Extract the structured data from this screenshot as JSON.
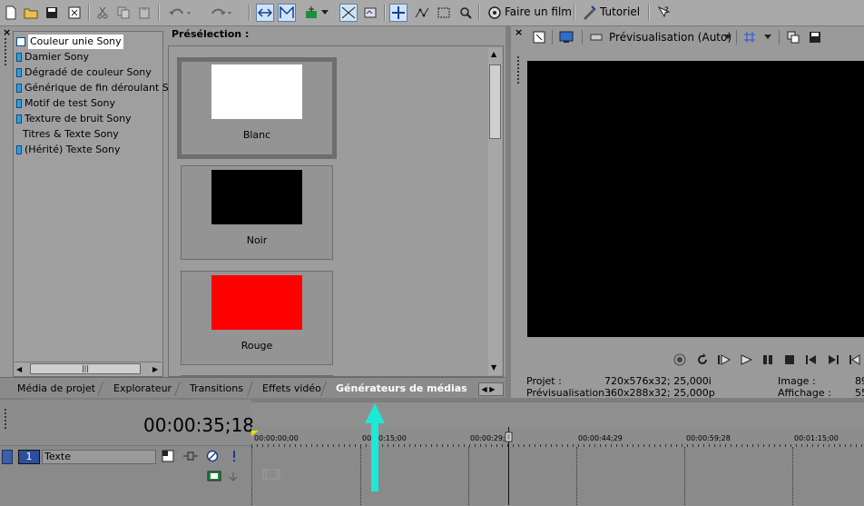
{
  "toolbar": {
    "make_movie_label": "Faire un film",
    "tutorial_label": "Tutoriel"
  },
  "generators": {
    "items": [
      "Couleur unie Sony",
      "Damier Sony",
      "Dégradé de couleur Sony",
      "Générique de fin déroulant Sony",
      "Motif de test Sony",
      "Texture de bruit Sony",
      "Titres & Texte Sony",
      "(Hérité) Texte Sony"
    ],
    "preset_heading": "Présélection :",
    "presets": [
      {
        "label": "Blanc",
        "color": "#ffffff"
      },
      {
        "label": "Noir",
        "color": "#000000"
      },
      {
        "label": "Rouge",
        "color": "#ff0000"
      }
    ]
  },
  "tabs": [
    "Média de projet",
    "Explorateur",
    "Transitions",
    "Effets vidéo",
    "Générateurs de médias"
  ],
  "preview": {
    "mode_label": "Prévisualisation (Auto)",
    "project_label": "Projet :",
    "project_value": "720x576x32; 25,000i",
    "preview_label": "Prévisualisation :",
    "preview_value": "360x288x32; 25,000p",
    "image_label": "Image :",
    "image_value": "89",
    "display_label": "Affichage :",
    "display_value": "55"
  },
  "timeline": {
    "timecode": "00:00:35;18",
    "track_number": "1",
    "track_name": "Texte",
    "ruler": [
      "00:00:00;00",
      "00:00:15;00",
      "00:00:29;",
      "00:00:44;29",
      "00:00:59;28",
      "00:01:15;00"
    ]
  },
  "colors": {
    "arrow": "#1ee8d6",
    "selected_tab": "#ffffff",
    "item_icon": "#2aa0e0"
  }
}
